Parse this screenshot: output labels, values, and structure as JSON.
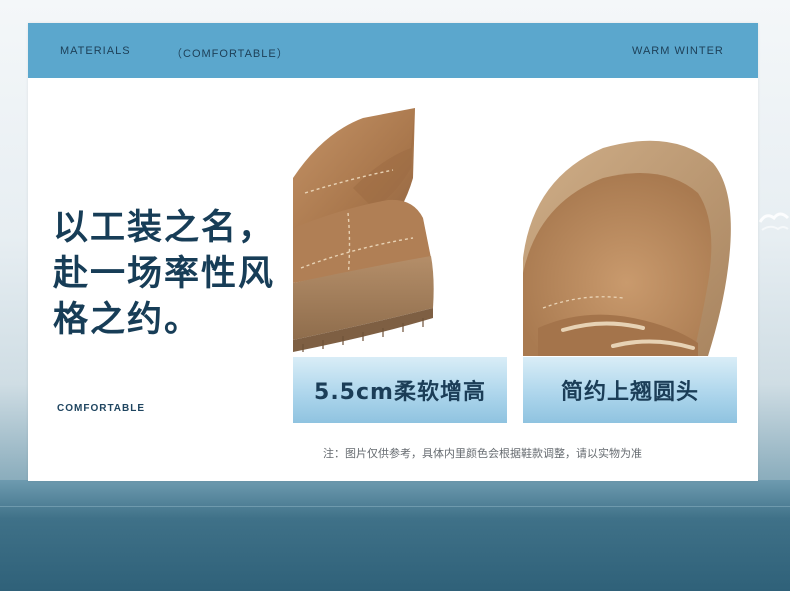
{
  "header": {
    "left_label": "MATERIALS",
    "mid_label": "（COMFORTABLE）",
    "right_label": "WARM WINTER"
  },
  "headline": {
    "lines": [
      "以工装之名，",
      "赴一场率性风",
      "格之约。"
    ]
  },
  "footer_label": "COMFORTABLE",
  "features": [
    {
      "label": "5.5cm柔软增高",
      "image": "boot-heel-sole-photo"
    },
    {
      "label": "简约上翘圆头",
      "image": "boot-rounded-toe-photo"
    }
  ],
  "note": "注：图片仅供参考，具体内里颜色会根据鞋款调整，请以实物为准",
  "colors": {
    "header_bg": "#5ba7cd",
    "headline": "#173d57",
    "suede": "#b4845a",
    "sole": "#a3805d"
  }
}
